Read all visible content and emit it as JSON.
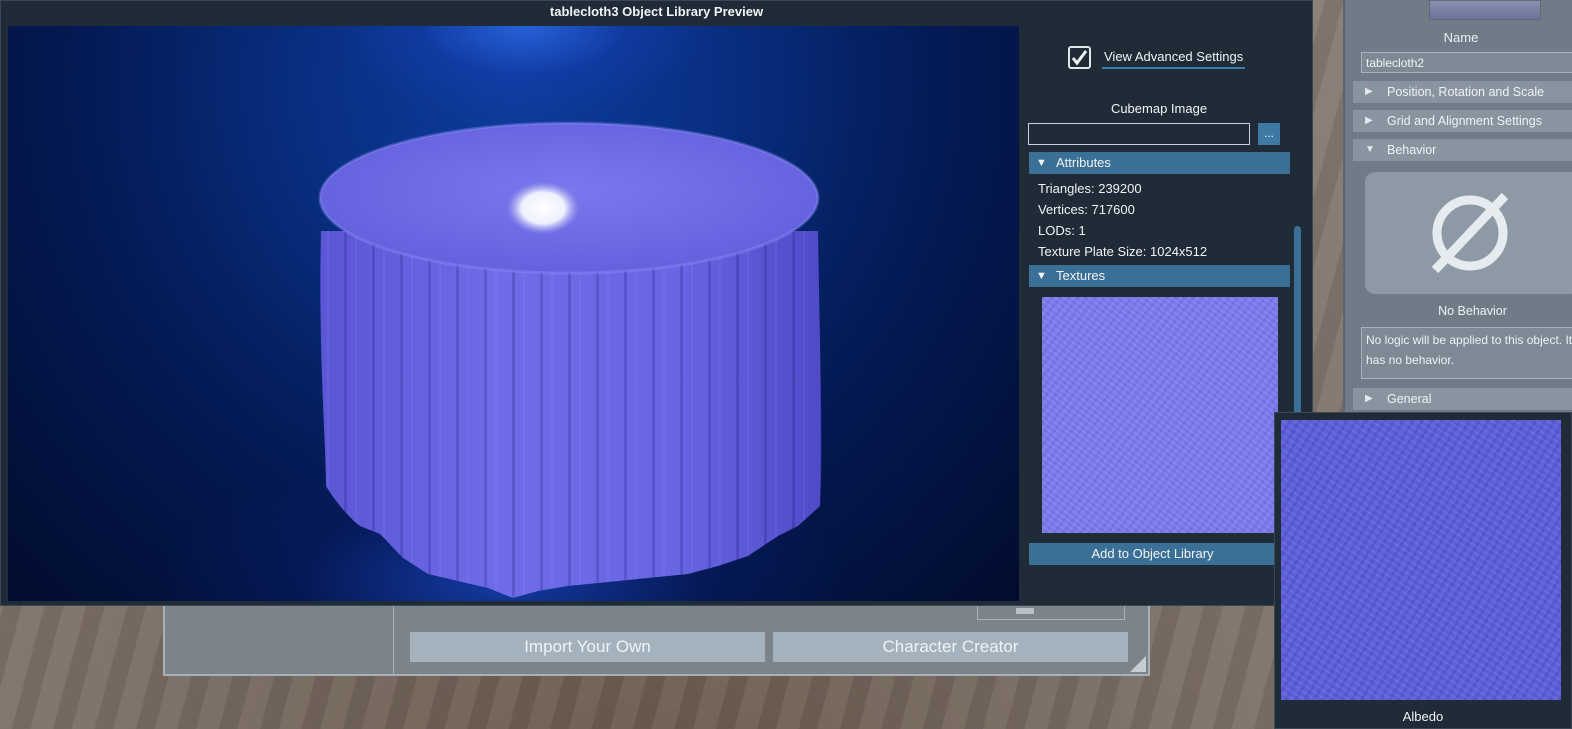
{
  "window": {
    "title": "tablecloth3 Object Library Preview"
  },
  "settings": {
    "advanced_label": "View Advanced Settings",
    "advanced_checked": true,
    "cubemap_label": "Cubemap Image",
    "cubemap_value": "",
    "browse_label": "..."
  },
  "attributes": {
    "header": "Attributes",
    "triangles": "Triangles: 239200",
    "vertices": "Vertices: 717600",
    "lods": "LODs: 1",
    "texture_plate": "Texture Plate Size: 1024x512"
  },
  "textures": {
    "header": "Textures"
  },
  "add_button": "Add to Object Library",
  "albedo": {
    "label": "Albedo"
  },
  "inspector": {
    "name_label": "Name",
    "name_value": "tablecloth2",
    "sections": [
      "Position, Rotation and Scale",
      "Grid and Alignment Settings",
      "Behavior",
      "General"
    ],
    "behavior_title": "No Behavior",
    "behavior_desc": "No logic will be applied to this object. It has no behavior."
  },
  "library": {
    "import_label": "Import Your Own",
    "creator_label": "Character Creator"
  },
  "icons": {
    "expanded": "triangle-down-icon",
    "collapsed": "triangle-right-icon",
    "no_behavior": "prohibited-circle-icon",
    "check": "check-icon"
  },
  "colors": {
    "accent": "#3a6f96",
    "window_bg": "#1f2b36",
    "cloth": "#6f6ce8"
  }
}
